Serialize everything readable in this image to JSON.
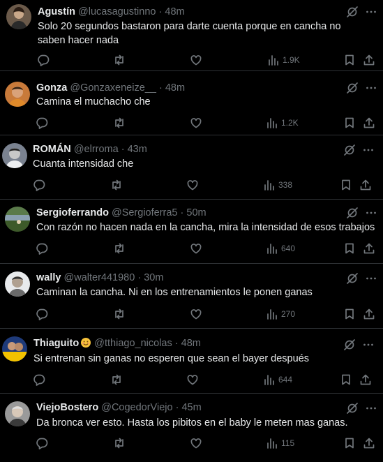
{
  "tweets": [
    {
      "name": "Agustín",
      "handle": "@lucasagustinno",
      "time": "48m",
      "text": "Solo 20 segundos bastaron para darte cuenta porque en cancha no saben hacer nada",
      "views": "1.9K",
      "avatar_color": "#8a7a6a"
    },
    {
      "name": "Gonza",
      "handle": "@Gonzaxeneize__",
      "time": "48m",
      "text": "Camina el muchacho che",
      "views": "1.2K",
      "avatar_color": "#c87a3a"
    },
    {
      "name": "ROMÁN",
      "handle": "@elrroma",
      "time": "43m",
      "text": "Cuanta intensidad che",
      "views": "338",
      "avatar_color": "#9aa2ac"
    },
    {
      "name": "Sergioferrando",
      "handle": "@Sergioferra5",
      "time": "50m",
      "text": "Con razón no hacen nada en la cancha, mira la intensidad de esos trabajos",
      "views": "640",
      "avatar_color": "#4a6a3a"
    },
    {
      "name": "wally",
      "handle": "@walter441980",
      "time": "30m",
      "text": "Caminan la cancha. Ni en los entrenamientos le ponen ganas",
      "views": "270",
      "avatar_color": "#d8dadc"
    },
    {
      "name": "Thiaguito",
      "handle": "@tthiago_nicolas",
      "time": "48m",
      "text": "Si entrenan sin ganas no esperen que sean el bayer después",
      "views": "644",
      "avatar_color": "#2a4a8a",
      "emoji": "smiling-face-emoji"
    },
    {
      "name": "ViejoBostero",
      "handle": "@CogedorViejo",
      "time": "45m",
      "text": "Da bronca ver esto. Hasta los pibitos en el baby le meten mas ganas.",
      "views": "115",
      "avatar_color": "#b0b0b0"
    }
  ],
  "separator": "·",
  "icons": {
    "grok": "grok-icon",
    "more": "more-options-icon",
    "reply": "reply-icon",
    "retweet": "retweet-icon",
    "like": "like-icon",
    "views": "views-icon",
    "bookmark": "bookmark-icon",
    "share": "share-icon"
  },
  "colors": {
    "background": "#000000",
    "text": "#e7e9ea",
    "muted": "#71767b",
    "divider": "#2f3336"
  }
}
